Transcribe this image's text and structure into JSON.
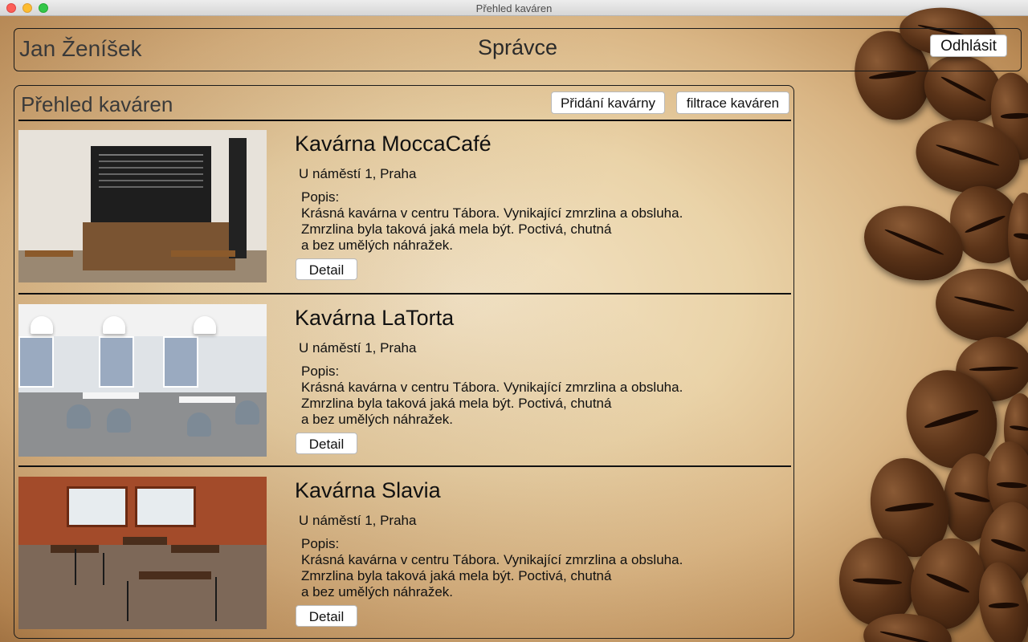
{
  "window": {
    "title": "Přehled kaváren"
  },
  "header": {
    "user_name": "Jan Ženíšek",
    "role": "Správce",
    "logout_label": "Odhlásit"
  },
  "panel": {
    "title": "Přehled kaváren",
    "add_label": "Přidání kavárny",
    "filter_label": "filtrace kaváren"
  },
  "cafes": [
    {
      "name": "Kavárna MoccaCafé",
      "address": "U náměstí 1, Praha",
      "description_label": "Popis:",
      "description": "Krásná kavárna v centru Tábora. Vynikající zmrzlina a obsluha.\nZmrzlina byla taková jaká mela být. Poctivá, chutná\na bez umělých náhražek.",
      "detail_label": "Detail"
    },
    {
      "name": "Kavárna LaTorta",
      "address": "U náměstí 1, Praha",
      "description_label": "Popis:",
      "description": "Krásná kavárna v centru Tábora. Vynikající zmrzlina a obsluha.\nZmrzlina byla taková jaká mela být. Poctivá, chutná\na bez umělých náhražek.",
      "detail_label": "Detail"
    },
    {
      "name": "Kavárna Slavia",
      "address": "U náměstí 1, Praha",
      "description_label": "Popis:",
      "description": "Krásná kavárna v centru Tábora. Vynikající zmrzlina a obsluha.\nZmrzlina byla taková jaká mela být. Poctivá, chutná\na bez umělých náhražek.",
      "detail_label": "Detail"
    }
  ]
}
